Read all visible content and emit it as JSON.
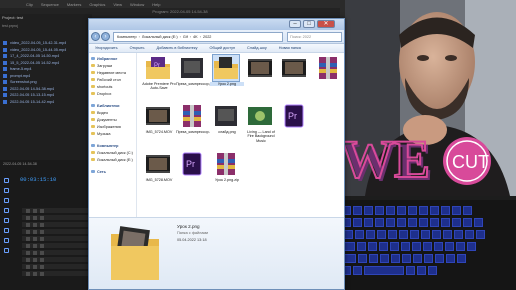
{
  "premiere": {
    "menu": [
      "Clip",
      "Sequence",
      "Markers",
      "Graphics",
      "View",
      "Window",
      "Help"
    ],
    "title": "Program: 2022-04-05 14-54-38",
    "project": {
      "header": "Project: test",
      "path": "test.prproj",
      "items": [
        "video_2022-04-05_15-42-31.mp4",
        "video_2022-04-05_15-44-05.mp4",
        "17_4_2022-04-05 14-50.mp4",
        "15_5_2022-04-05 14-52.mp4",
        "frame-5.mp4",
        "prompt.mp4",
        "Screenshot.png",
        "2022-04-05 14-54-38.mp4",
        "2022-04-05 15-13-15.mp4",
        "2022-04-05 15-14-42.mp4"
      ]
    },
    "timeline": {
      "tab": "2022-04-05 14-54-38",
      "timecode": "00:03:15:10"
    }
  },
  "explorer": {
    "address": [
      "Компьютер",
      "Локальный диск (E:)",
      "Gif",
      "4K",
      "2022"
    ],
    "search_placeholder": "Поиск: 2022",
    "toolbar": [
      "Упорядочить",
      "Открыть",
      "Добавить в библиотеку",
      "Общий доступ",
      "Слайд-шоу",
      "Новая папка"
    ],
    "nav": [
      {
        "label": "Избранное",
        "group": true
      },
      {
        "label": "Загрузки",
        "group": false
      },
      {
        "label": "Недавние места",
        "group": false
      },
      {
        "label": "Рабочий стол",
        "group": false
      },
      {
        "label": "shortcuts",
        "group": false
      },
      {
        "label": "Dropbox",
        "group": false
      },
      {
        "label": "Библиотеки",
        "group": true
      },
      {
        "label": "Видео",
        "group": false
      },
      {
        "label": "Документы",
        "group": false
      },
      {
        "label": "Изображения",
        "group": false
      },
      {
        "label": "Музыка",
        "group": false
      },
      {
        "label": "Компьютер",
        "group": true
      },
      {
        "label": "Локальный диск (C:)",
        "group": false
      },
      {
        "label": "Локальный диск (E:)",
        "group": false
      },
      {
        "label": "Сеть",
        "group": true
      }
    ],
    "files": [
      {
        "name": "Adobe Premiere Pro Auto-Save",
        "kind": "folder"
      },
      {
        "name": "Преза_компрессор.png",
        "kind": "image-dark"
      },
      {
        "name": "Урок 2.png",
        "kind": "folder-sel"
      },
      {
        "name": "",
        "kind": "film"
      },
      {
        "name": "",
        "kind": "film"
      },
      {
        "name": "",
        "kind": "archive"
      },
      {
        "name": "IMG_5724.MOV",
        "kind": "film"
      },
      {
        "name": "Преза_компрессор.zip",
        "kind": "archive"
      },
      {
        "name": "слайд.png",
        "kind": "image-dark"
      },
      {
        "name": "Living — Land of Fire Background Music",
        "kind": "image-green"
      },
      {
        "name": "",
        "kind": "pr"
      },
      {
        "name": "IMG_5728.MOV",
        "kind": "film"
      },
      {
        "name": "",
        "kind": "pr"
      },
      {
        "name": "Урок 2.png.zip",
        "kind": "archive"
      }
    ],
    "details": {
      "name": "Урок 2.png",
      "type": "Папка с файлами",
      "date": "05.04.2022 13:18"
    }
  },
  "logo": {
    "text1": "WE",
    "text2": "CUT"
  },
  "colors": {
    "keyboard_key": "#1e2f8c",
    "logo_pink": "#d84a9a",
    "logo_purple": "#6b2f6e"
  }
}
